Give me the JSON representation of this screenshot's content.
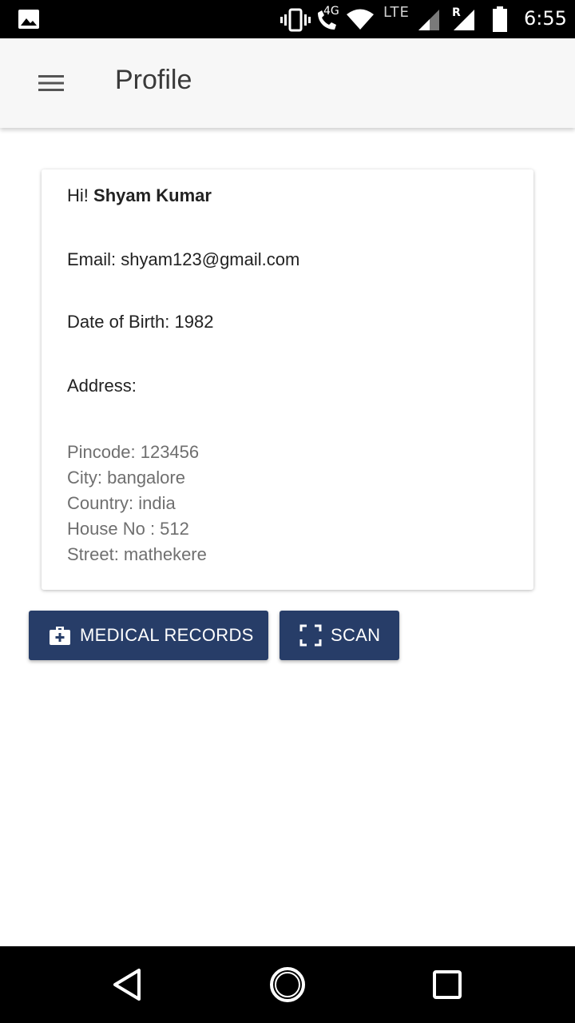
{
  "status_bar": {
    "network_label": "4G",
    "lte_label": "LTE",
    "roaming_label": "R",
    "time": "6:55",
    "icons": [
      "image-icon",
      "vibrate-icon",
      "wifi-call-icon",
      "wifi-icon",
      "signal-icon",
      "roaming-signal-icon",
      "battery-icon"
    ]
  },
  "app_bar": {
    "title": "Profile",
    "menu_icon": "hamburger-menu-icon"
  },
  "profile": {
    "greeting_prefix": "Hi!",
    "name": "Shyam Kumar",
    "email": "Email: shyam123@gmail.com",
    "dob": "Date of Birth: 1982",
    "address_label": "Address:",
    "address_lines": [
      "Pincode: 123456",
      "City: bangalore",
      "Country: india",
      "House No : 512",
      "Street: mathekere"
    ]
  },
  "actions": {
    "medical_records_label": "MEDICAL RECORDS",
    "medical_records_icon": "medical-kit-icon",
    "scan_label": "SCAN",
    "scan_icon": "scan-frame-icon"
  },
  "nav_bar": {
    "icons": [
      "back-icon",
      "home-icon",
      "recents-icon"
    ]
  },
  "colors": {
    "primary_button": "#273d68",
    "app_bar_bg": "#f7f7f7",
    "status_bar_bg": "#000000"
  }
}
